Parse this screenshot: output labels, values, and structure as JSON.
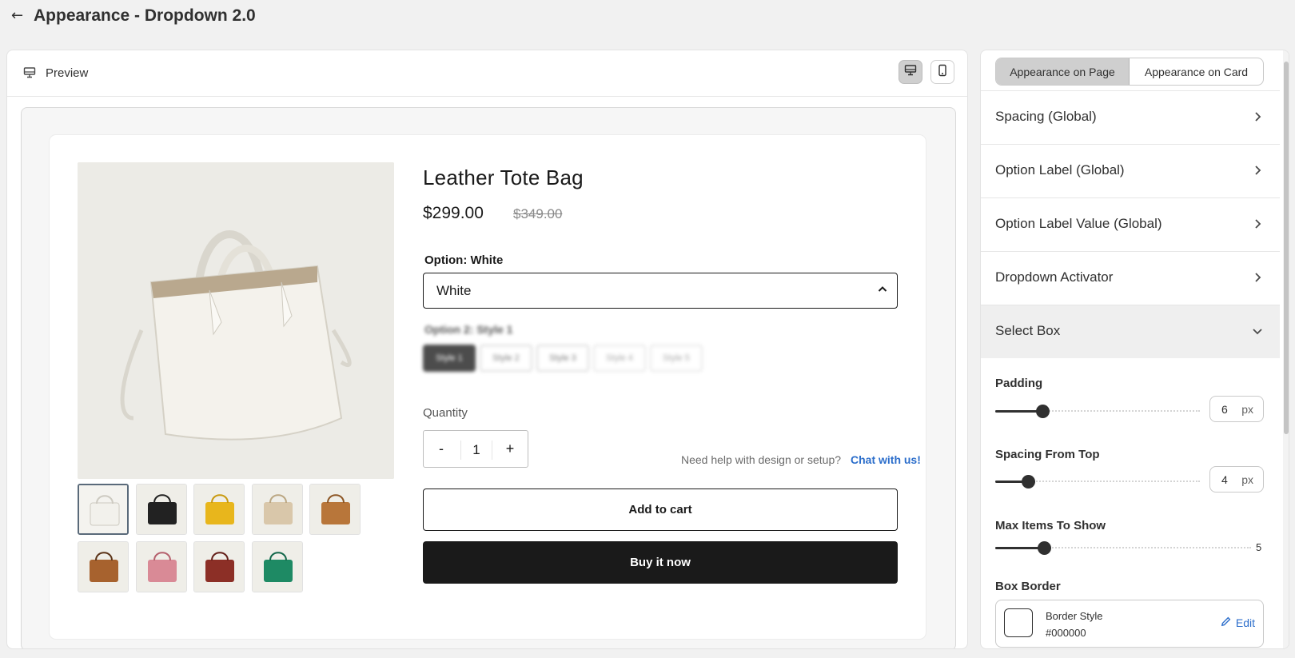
{
  "header": {
    "back_icon": "arrow-left-icon",
    "title": "Appearance - Dropdown 2.0"
  },
  "preview": {
    "label": "Preview",
    "label_icon": "desktop-icon",
    "device_desktop_icon": "desktop-icon",
    "device_mobile_icon": "mobile-icon"
  },
  "product": {
    "title": "Leather Tote Bag",
    "price": "$299.00",
    "compare_price": "$349.00",
    "option_label": "Option: White",
    "select_value": "White",
    "option2_label": "Option 2: Style 1",
    "styles": [
      "Style 1",
      "Style 2",
      "Style 3",
      "Style 4",
      "Style 5"
    ],
    "quantity_label": "Quantity",
    "quantity_value": "1",
    "qty_minus": "-",
    "qty_plus": "+",
    "help_text": "Need help with design or setup?",
    "help_link": "Chat with us!",
    "add_to_cart": "Add to cart",
    "buy_now": "Buy it now",
    "thumbnail_colors": [
      "#f2f1ec",
      "#222222",
      "#e8b61c",
      "#d9c7aa",
      "#b8763a",
      "#a7622e",
      "#d98a96",
      "#8c2f26",
      "#1e8a64"
    ]
  },
  "settings": {
    "tabs": [
      "Appearance on Page",
      "Appearance on Card"
    ],
    "sections": [
      "Spacing (Global)",
      "Option Label (Global)",
      "Option Label Value (Global)",
      "Dropdown Activator",
      "Select Box"
    ],
    "padding": {
      "label": "Padding",
      "value": "6",
      "unit": "px",
      "level": 0.23
    },
    "spacing_top": {
      "label": "Spacing From Top",
      "value": "4",
      "unit": "px",
      "level": 0.16
    },
    "max_items": {
      "label": "Max Items To Show",
      "value": "5",
      "level": 0.19
    },
    "box_border": {
      "label": "Box Border",
      "style_label": "Border Style",
      "hex": "#000000",
      "edit": "Edit"
    }
  }
}
